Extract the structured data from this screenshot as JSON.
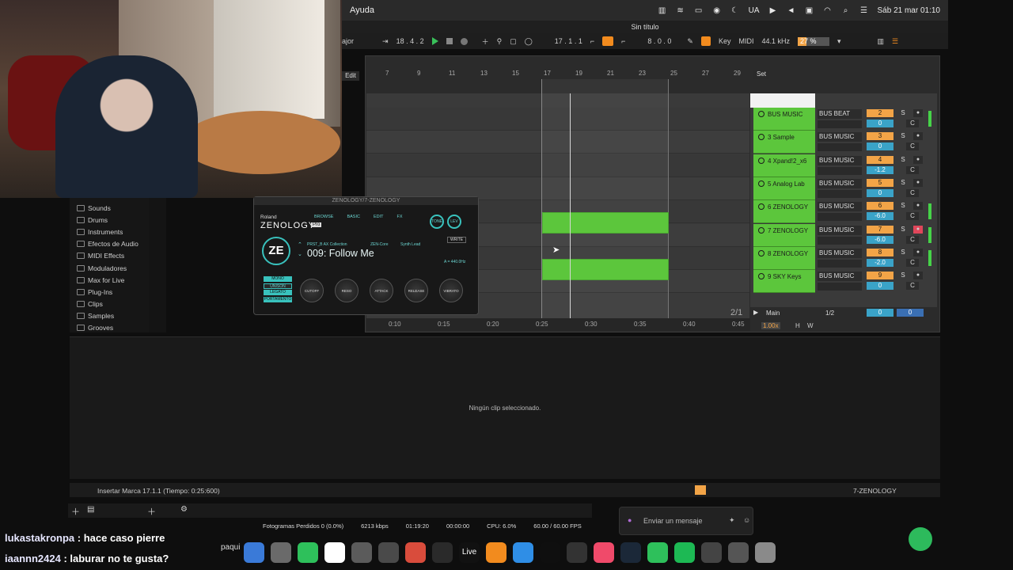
{
  "menubar": {
    "app_menu": "Ayuda",
    "clock": "Sáb 21 mar  01:10",
    "input_indicator": "UA"
  },
  "window": {
    "title": "Sin título"
  },
  "transport": {
    "scale_label": "ajor",
    "position": "18 .  4 .  2",
    "loop_start": "17 .  1 .  1",
    "loop_length": "8 .  0 .  0",
    "key_label": "Key",
    "midi_label": "MIDI",
    "sample_rate": "44.1 kHz",
    "cpu_pct": "27 %",
    "cpu_fill": 0.27
  },
  "browser": {
    "items": [
      "Sounds",
      "Drums",
      "Instruments",
      "Efectos de Audio",
      "MIDI Effects",
      "Moduladores",
      "Max for Live",
      "Plug-Ins",
      "Clips",
      "Samples",
      "Grooves"
    ]
  },
  "arrangement": {
    "edit_label": "Edit",
    "ruler": [
      "7",
      "9",
      "11",
      "13",
      "15",
      "17",
      "19",
      "21",
      "23",
      "25",
      "27",
      "29"
    ],
    "timeline": [
      "0:10",
      "0:15",
      "0:20",
      "0:25",
      "0:30",
      "0:35",
      "0:40",
      "0:45"
    ],
    "set_label": "Set",
    "page_indicator": "2/1"
  },
  "tracks": [
    {
      "name": "BUS MUSIC",
      "routing": "BUS BEAT",
      "number": "2",
      "volume": "0",
      "pan": "C"
    },
    {
      "name": "3 Sample",
      "routing": "BUS MUSIC",
      "number": "3",
      "volume": "0",
      "pan": "C"
    },
    {
      "name": "4 Xpand!2_x6",
      "routing": "BUS MUSIC",
      "number": "4",
      "volume": "-1.2",
      "pan": "C"
    },
    {
      "name": "5 Analog Lab",
      "routing": "BUS MUSIC",
      "number": "5",
      "volume": "0",
      "pan": "C"
    },
    {
      "name": "6 ZENOLOGY",
      "routing": "BUS MUSIC",
      "number": "6",
      "volume": "-6.0",
      "pan": "C"
    },
    {
      "name": "7 ZENOLOGY",
      "routing": "BUS MUSIC",
      "number": "7",
      "volume": "-6.0",
      "pan": "C"
    },
    {
      "name": "8 ZENOLOGY",
      "routing": "BUS MUSIC",
      "number": "8",
      "volume": "-2.0",
      "pan": "C"
    },
    {
      "name": "9 SKY Keys",
      "routing": "BUS MUSIC",
      "number": "9",
      "volume": "0",
      "pan": "C"
    }
  ],
  "main_track": {
    "name": "Main",
    "routing": "1/2",
    "volume": "0",
    "pan": "0",
    "tempo": "1.00x",
    "h": "H",
    "w": "W"
  },
  "plugin": {
    "title": "ZENOLOGY/7-ZENOLOGY",
    "brand": "Roland",
    "name": "ZENOLOGY",
    "edition": "Pro",
    "tabs": [
      "BROWSE",
      "BASIC",
      "EDIT",
      "FX"
    ],
    "logo": "ZE",
    "collection": "PRST_B AX Collection",
    "engine": "ZEN-Core",
    "category": "Synth Lead",
    "preset": "009:  Follow Me",
    "write_label": "WRITE",
    "tuning": "A = 440.0Hz",
    "modes": [
      "MONO",
      "UNISON",
      "LEGATO",
      "PORTAMENTO"
    ],
    "knobs": [
      "CUTOFF",
      "RESO",
      "ATTACK",
      "RELEASE",
      "VIBRATO"
    ],
    "top_knobs": [
      "TONE",
      "LEV"
    ]
  },
  "detail": {
    "empty_message": "Ningún clip seleccionado."
  },
  "statusbar": {
    "message": "Insertar Marca 17.1.1 (Tiempo: 0:25:600)",
    "selected_track": "7-ZENOLOGY"
  },
  "obs": {
    "dropped_frames": "Fotogramas Perdidos 0 (0.0%)",
    "bitrate": "6213 kbps",
    "stream_time": "01:19:20",
    "rec_time": "00:00:00",
    "cpu": "CPU: 6.0%",
    "fps": "60.00 / 60.00 FPS"
  },
  "discord": {
    "placeholder": "Enviar un mensaje"
  },
  "dock": {
    "live_label": "Live",
    "obs_label": "paqui",
    "icons": [
      "finder-icon",
      "launchpad-icon",
      "whatsapp-icon",
      "capcut-icon",
      "logic-icon",
      "maschine-icon",
      "chrome-icon",
      "obs-icon",
      "live-icon",
      "fl-studio-icon",
      "safari-icon",
      "tidal-icon",
      "waves-icon",
      "music-icon",
      "steam-icon",
      "facetime-icon",
      "spotify-icon",
      "screen-icon",
      "photo-icon",
      "trash-icon"
    ],
    "icon_colors": [
      "#3a7ad8",
      "#6a6a6a",
      "#2ec05b",
      "#ffffff",
      "#5b5b5b",
      "#4a4a4a",
      "#d94c3c",
      "#2a2a2a",
      "#111111",
      "#f28b1e",
      "#2f8ee6",
      "#0f0f0f",
      "#333333",
      "#f04a6a",
      "#1b2838",
      "#2ec05b",
      "#1db954",
      "#444444",
      "#555555",
      "#8a8a8a"
    ]
  },
  "chat": [
    {
      "user": "lukastakronpa",
      "text": ": hace caso pierre"
    },
    {
      "user": "iaannn2424",
      "text": ": laburar no te gusta?"
    }
  ],
  "colors": {
    "clip_green": "#5cc63c",
    "accent_orange": "#f2a447",
    "volume_blue": "#3aa3c8",
    "zen_teal": "#39c2bd"
  }
}
